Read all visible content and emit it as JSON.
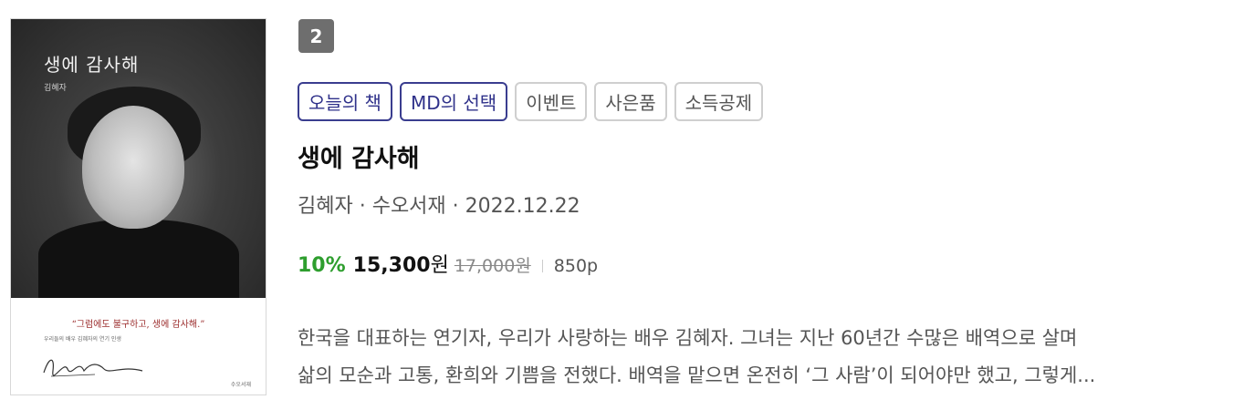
{
  "book": {
    "rank": "2",
    "tags": [
      "오늘의 책",
      "MD의 선택",
      "이벤트",
      "사은품",
      "소득공제"
    ],
    "title": "생에 감사해",
    "meta": "김혜자 · 수오서재 · 2022.12.22",
    "price": {
      "discount": "10%",
      "sale": "15,300",
      "currency": "원",
      "original": "17,000원",
      "pages": "850p"
    },
    "description": [
      "한국을 대표하는 연기자, 우리가 사랑하는 배우 김혜자. 그녀는 지난 60년간 수많은 배역으로 살며",
      "삶의 모순과 고통, 환희와 기쁨을 전했다. 배역을 맡으면 온전히 ‘그 사람’이 되어야만 했고, 그렇게..."
    ],
    "cover": {
      "title": "생에 감사해",
      "author": "김혜자",
      "quote": "“그럼에도 불구하고, 생에 감사해.”",
      "subtitle": "우리들의 배우 김혜자의 연기 인생",
      "publisher": "수오서재"
    }
  },
  "colors": {
    "tag_primary": "#3a3d8f",
    "discount": "#2e9e2e",
    "rank_bg": "#6e6e6e"
  }
}
